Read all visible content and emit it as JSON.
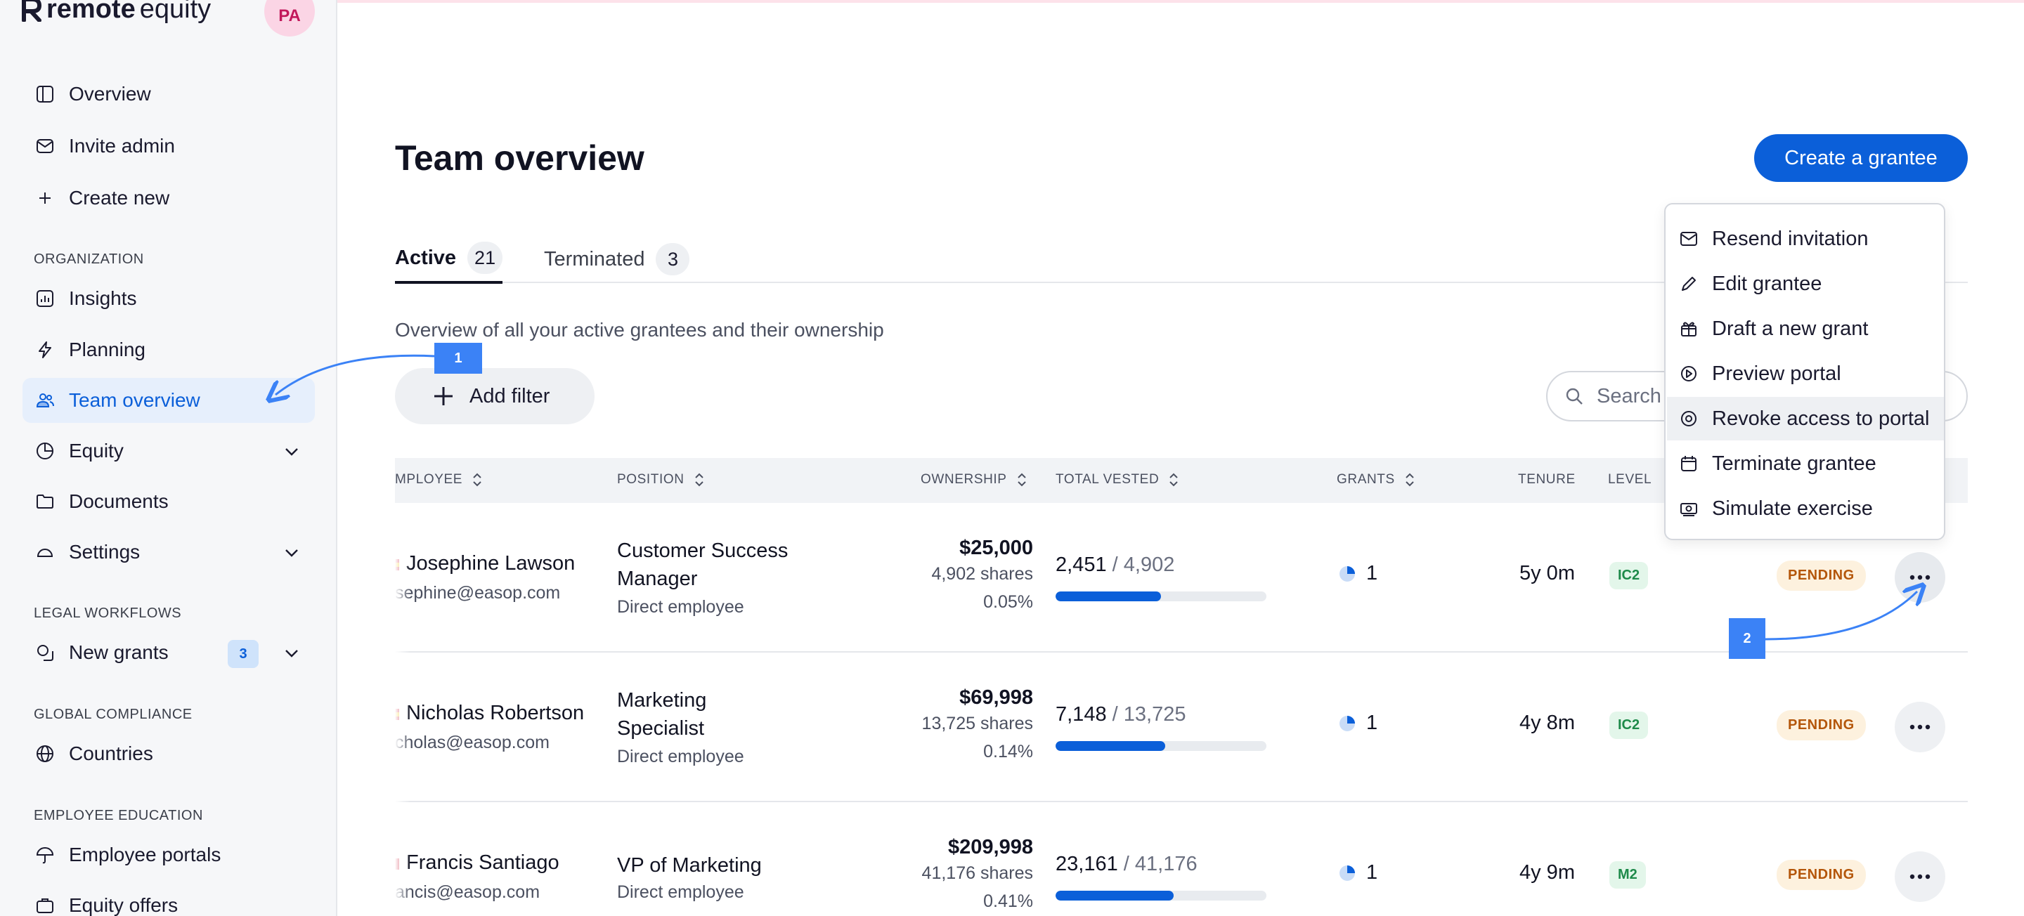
{
  "brand": {
    "logo_text_bold": "remote",
    "logo_text_light": "equity"
  },
  "user": {
    "initials": "PA"
  },
  "sidebar": {
    "top_items": [
      {
        "label": "Overview",
        "icon": "layout-icon"
      },
      {
        "label": "Invite admin",
        "icon": "mail-icon"
      },
      {
        "label": "Create new",
        "icon": "plus-icon"
      }
    ],
    "sections": [
      {
        "title": "ORGANIZATION"
      },
      {
        "title": "LEGAL WORKFLOWS"
      },
      {
        "title": "GLOBAL COMPLIANCE"
      },
      {
        "title": "EMPLOYEE EDUCATION"
      }
    ],
    "org_items": [
      {
        "label": "Insights",
        "icon": "chart-icon"
      },
      {
        "label": "Planning",
        "icon": "bolt-icon"
      },
      {
        "label": "Team overview",
        "icon": "users-icon",
        "active": true
      },
      {
        "label": "Equity",
        "icon": "pie-icon"
      },
      {
        "label": "Documents",
        "icon": "folder-icon"
      },
      {
        "label": "Settings",
        "icon": "gauge-icon"
      }
    ],
    "legal_items": [
      {
        "label": "New grants",
        "icon": "copy-icon",
        "count": "3"
      }
    ],
    "compliance_items": [
      {
        "label": "Countries",
        "icon": "globe-icon"
      }
    ],
    "education_items": [
      {
        "label": "Employee portals",
        "icon": "umbrella-icon"
      },
      {
        "label": "Equity offers",
        "icon": "briefcase-icon"
      }
    ]
  },
  "main": {
    "title": "Team overview",
    "create_button": "Create a grantee",
    "tabs": [
      {
        "label": "Active",
        "count": "21",
        "active": true
      },
      {
        "label": "Terminated",
        "count": "3"
      }
    ],
    "subtitle": "Overview of all your active grantees and their ownership",
    "add_filter": "Add filter",
    "search_placeholder": "Search"
  },
  "table": {
    "columns": [
      "MPLOYEE",
      "POSITION",
      "OWNERSHIP",
      "TOTAL VESTED",
      "GRANTS",
      "TENURE",
      "LEVEL"
    ],
    "rows": [
      {
        "name": "Josephine Lawson",
        "email": "sephine@easop.com",
        "position": "Customer Success Manager",
        "position_type": "Direct employee",
        "value": "$25,000",
        "shares": "4,902 shares",
        "percent": "0.05%",
        "vested": "2,451",
        "vested_total": "/ 4,902",
        "vested_fraction": 0.5,
        "grants": "1",
        "tenure": "5y 0m",
        "level": "IC2",
        "status": "PENDING"
      },
      {
        "name": "Nicholas Robertson",
        "email": "cholas@easop.com",
        "position": "Marketing Specialist",
        "position_type": "Direct employee",
        "value": "$69,998",
        "shares": "13,725 shares",
        "percent": "0.14%",
        "vested": "7,148",
        "vested_total": "/ 13,725",
        "vested_fraction": 0.52,
        "grants": "1",
        "tenure": "4y 8m",
        "level": "IC2",
        "status": "PENDING"
      },
      {
        "name": "Francis Santiago",
        "email": "ancis@easop.com",
        "position": "VP of Marketing",
        "position_type": "Direct employee",
        "value": "$209,998",
        "shares": "41,176 shares",
        "percent": "0.41%",
        "vested": "23,161",
        "vested_total": "/ 41,176",
        "vested_fraction": 0.56,
        "grants": "1",
        "tenure": "4y 9m",
        "level": "M2",
        "status": "PENDING"
      }
    ]
  },
  "menu": {
    "items": [
      {
        "label": "Resend invitation",
        "icon": "mail-icon"
      },
      {
        "label": "Edit grantee",
        "icon": "pencil-icon"
      },
      {
        "label": "Draft a new grant",
        "icon": "gift-icon"
      },
      {
        "label": "Preview portal",
        "icon": "play-circle-icon"
      },
      {
        "label": "Revoke access to portal",
        "icon": "target-icon",
        "hover": true
      },
      {
        "label": "Terminate grantee",
        "icon": "calendar-icon"
      },
      {
        "label": "Simulate exercise",
        "icon": "cash-icon"
      }
    ]
  },
  "annotations": [
    {
      "label": "1"
    },
    {
      "label": "2"
    }
  ],
  "colors": {
    "accent": "#0b5fd9",
    "annotation": "#3b82f6",
    "level_green": "#1e8a4a",
    "pending_orange": "#b4560a"
  }
}
